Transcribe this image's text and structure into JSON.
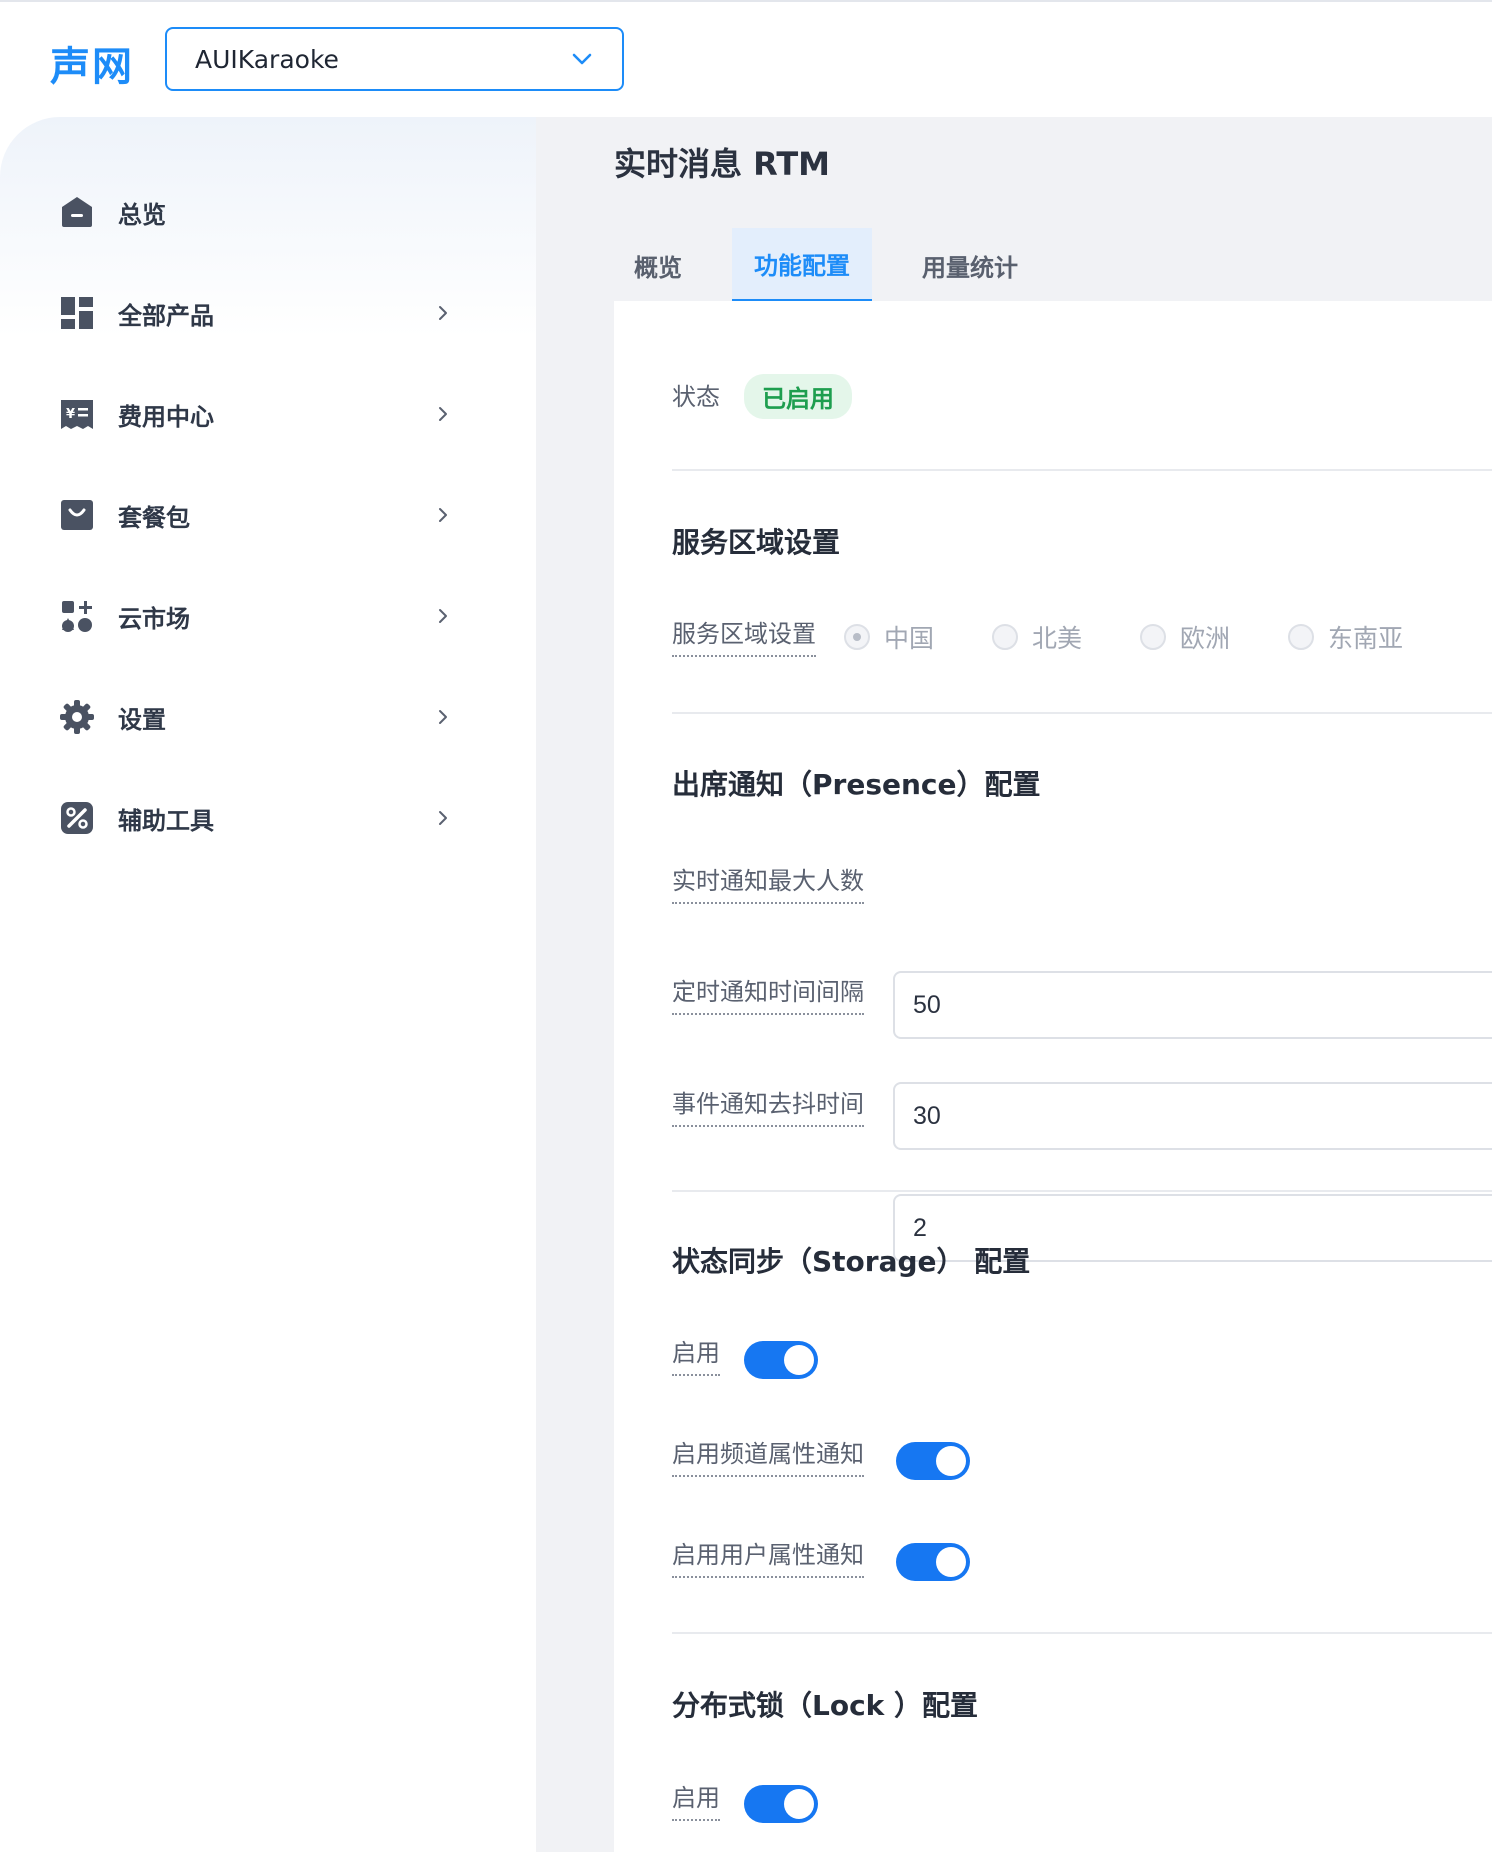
{
  "header": {
    "logo_text": "声网",
    "project_select": {
      "value": "AUIKaraoke"
    }
  },
  "sidebar": {
    "items": [
      {
        "label": "总览",
        "icon": "home-icon",
        "has_arrow": false
      },
      {
        "label": "全部产品",
        "icon": "grid-icon",
        "has_arrow": true
      },
      {
        "label": "费用中心",
        "icon": "billing-icon",
        "has_arrow": true
      },
      {
        "label": "套餐包",
        "icon": "package-icon",
        "has_arrow": true
      },
      {
        "label": "云市场",
        "icon": "marketplace-icon",
        "has_arrow": true
      },
      {
        "label": "设置",
        "icon": "gear-icon",
        "has_arrow": true
      },
      {
        "label": "辅助工具",
        "icon": "tools-icon",
        "has_arrow": true
      }
    ]
  },
  "main": {
    "title": "实时消息 RTM",
    "tabs": [
      {
        "label": "概览",
        "active": false
      },
      {
        "label": "功能配置",
        "active": true
      },
      {
        "label": "用量统计",
        "active": false
      }
    ],
    "status": {
      "label": "状态",
      "badge": "已启用"
    },
    "region_section": {
      "title": "服务区域设置",
      "field_label": "服务区域设置",
      "options": [
        {
          "label": "中国",
          "selected": true
        },
        {
          "label": "北美",
          "selected": false
        },
        {
          "label": "欧洲",
          "selected": false
        },
        {
          "label": "东南亚",
          "selected": false
        }
      ]
    },
    "presence_section": {
      "title": "出席通知（Presence）配置",
      "fields": [
        {
          "label": "实时通知最大人数",
          "value": "50"
        },
        {
          "label": "定时通知时间间隔",
          "value": "30"
        },
        {
          "label": "事件通知去抖时间",
          "value": "2"
        }
      ]
    },
    "storage_section": {
      "title": "状态同步（Storage） 配置",
      "toggles": [
        {
          "label": "启用",
          "on": true
        },
        {
          "label": "启用频道属性通知",
          "on": true
        },
        {
          "label": "启用用户属性通知",
          "on": true
        }
      ]
    },
    "lock_section": {
      "title": "分布式锁（Lock ）配置",
      "toggles": [
        {
          "label": "启用",
          "on": true
        }
      ]
    }
  },
  "colors": {
    "accent": "#1d8cf8",
    "toggle_on": "#1677f2",
    "badge_bg": "#e4f6ea",
    "badge_text": "#1e9e4f"
  }
}
